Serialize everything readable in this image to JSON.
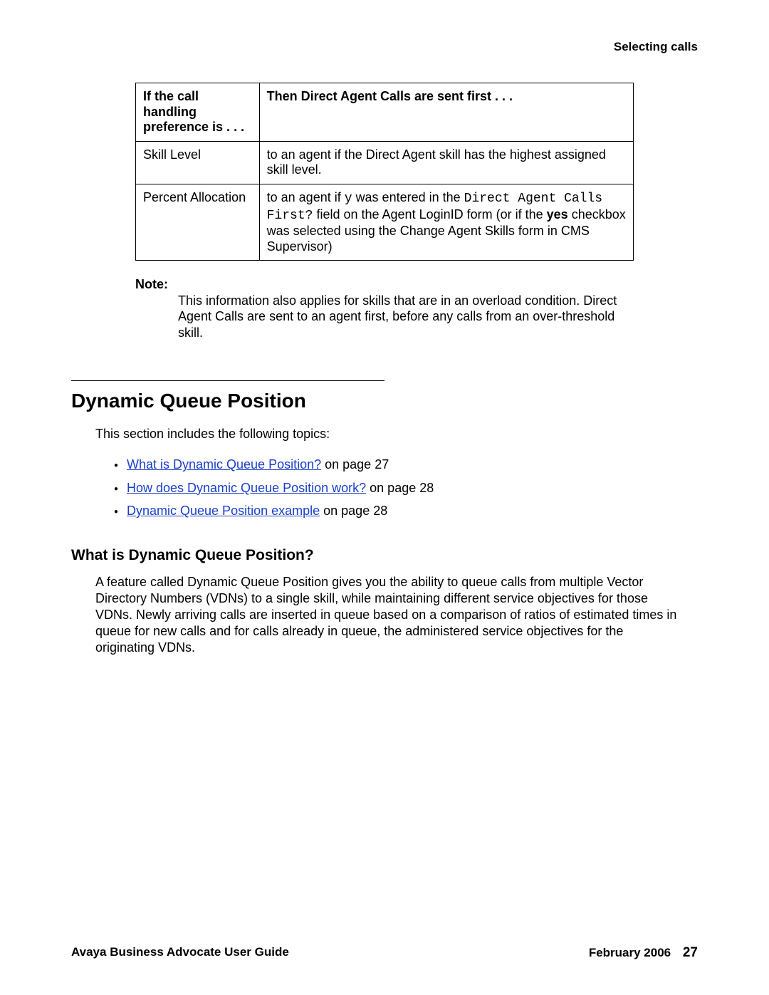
{
  "running_head": "Selecting calls",
  "table": {
    "head_left": "If the call handling preference is . . .",
    "head_right": "Then Direct Agent Calls are sent first . . .",
    "rows": [
      {
        "c1": "Skill Level",
        "c2": "to an agent if the Direct Agent skill has the highest assigned skill level."
      },
      {
        "c1": "Percent Allocation",
        "c2_1": "to an agent if ",
        "c2_mono1": "y",
        "c2_2": " was entered in the ",
        "c2_mono2": "Direct Agent Calls First?",
        "c2_3": " field on the Agent LoginID form (or if the ",
        "c2_bold": "yes",
        "c2_4": " checkbox was selected using the Change Agent Skills form in CMS Supervisor)"
      }
    ]
  },
  "note": {
    "label": "Note:",
    "text": "This information also applies for skills that are in an overload condition. Direct Agent Calls are sent to an agent first, before any calls from an over-threshold skill."
  },
  "section_title": "Dynamic Queue Position",
  "intro": "This section includes the following topics:",
  "topics": [
    {
      "link": "What is Dynamic Queue Position?",
      "suffix": " on page 27"
    },
    {
      "link": "How does Dynamic Queue Position work?",
      "suffix": " on page 28"
    },
    {
      "link": "Dynamic Queue Position example",
      "suffix": " on page 28"
    }
  ],
  "sub_heading": "What is Dynamic Queue Position?",
  "body": "A feature called Dynamic Queue Position gives you the ability to queue calls from multiple Vector Directory Numbers (VDNs) to a single skill, while maintaining different service objectives for those VDNs. Newly arriving calls are inserted in queue based on a comparison of ratios of estimated times in queue for new calls and for calls already in queue, the administered service objectives for the originating VDNs.",
  "footer": {
    "left": "Avaya Business Advocate User Guide",
    "right_date": "February 2006",
    "page_number": "27"
  }
}
